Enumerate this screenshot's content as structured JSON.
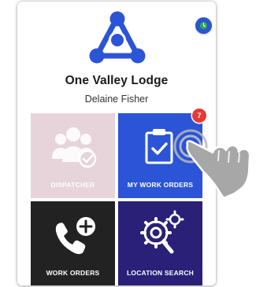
{
  "app": {
    "org_name": "One Valley Lodge",
    "user_name": "Delaine Fisher"
  },
  "status": {
    "icon": "clock-icon"
  },
  "tiles": [
    {
      "label": "DISPATCHER",
      "icon": "people-check-icon",
      "enabled": false
    },
    {
      "label": "MY WORK ORDERS",
      "icon": "clipboard-check-icon",
      "badge": "7"
    },
    {
      "label": "WORK ORDERS",
      "icon": "phone-plus-icon"
    },
    {
      "label": "LOCATION SEARCH",
      "icon": "gears-search-icon"
    }
  ],
  "colors": {
    "brand_blue": "#2b54d6",
    "dispatcher_tile": "#e6d4da",
    "work_orders_tile": "#222222",
    "location_tile": "#2a2077",
    "badge_red": "#e43b37"
  }
}
